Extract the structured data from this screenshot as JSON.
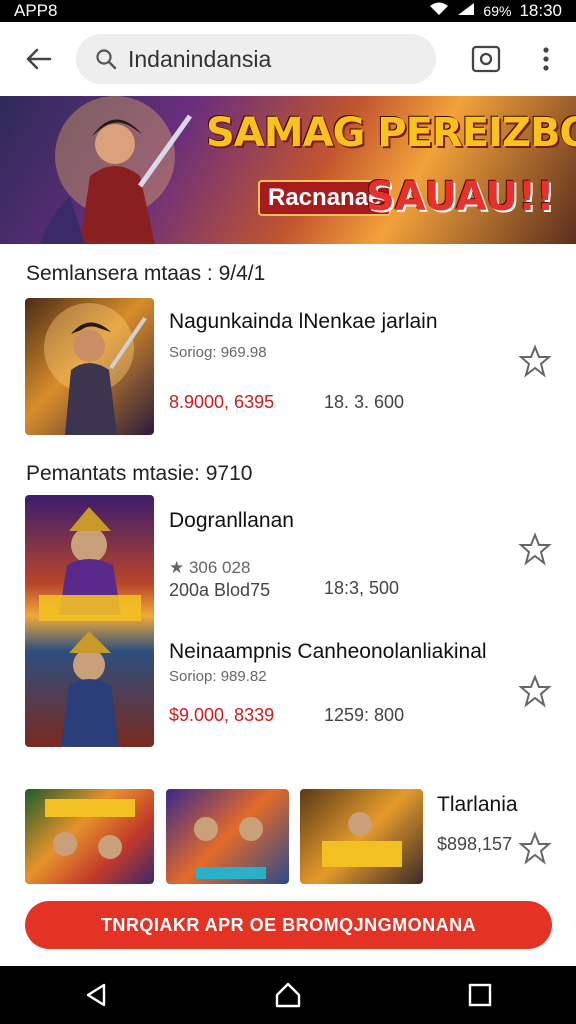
{
  "status_bar": {
    "app_name": "APP8",
    "battery": "69%",
    "time": "18:30"
  },
  "search": {
    "value": "Indanindansia"
  },
  "banner": {
    "line1": "SAMAG PEREIZBON!",
    "line2": "Racnanae",
    "line3": "SAUAU!!"
  },
  "sections": [
    {
      "title": "Semlansera mtaas : 9/4/1",
      "items": [
        {
          "title": "Nagunkainda lNenkae  jarlain",
          "sub": "Soriog: 969.98",
          "price": "8.9000, 6395",
          "meta": "18. 3. 600"
        }
      ]
    },
    {
      "title": "Pemantats mtasie: 9710",
      "items": [
        {
          "title": "Dogranllanan",
          "sub": "★ 306 028",
          "sub2": "200a Blod75",
          "meta": "18:3, 500"
        },
        {
          "title": "Neinaampnis Canheonolanliakinal",
          "sub": "Soriop: 989.82",
          "price": "$9.000, 8339",
          "meta": "1259: 800"
        }
      ]
    }
  ],
  "row": {
    "title": "Tlarlania",
    "price": "$898,157"
  },
  "cta": {
    "label": "TNRQIAKR APR OE BROMQJNGMONANA"
  },
  "colors": {
    "accent": "#e43225",
    "price": "#d01c1c"
  }
}
